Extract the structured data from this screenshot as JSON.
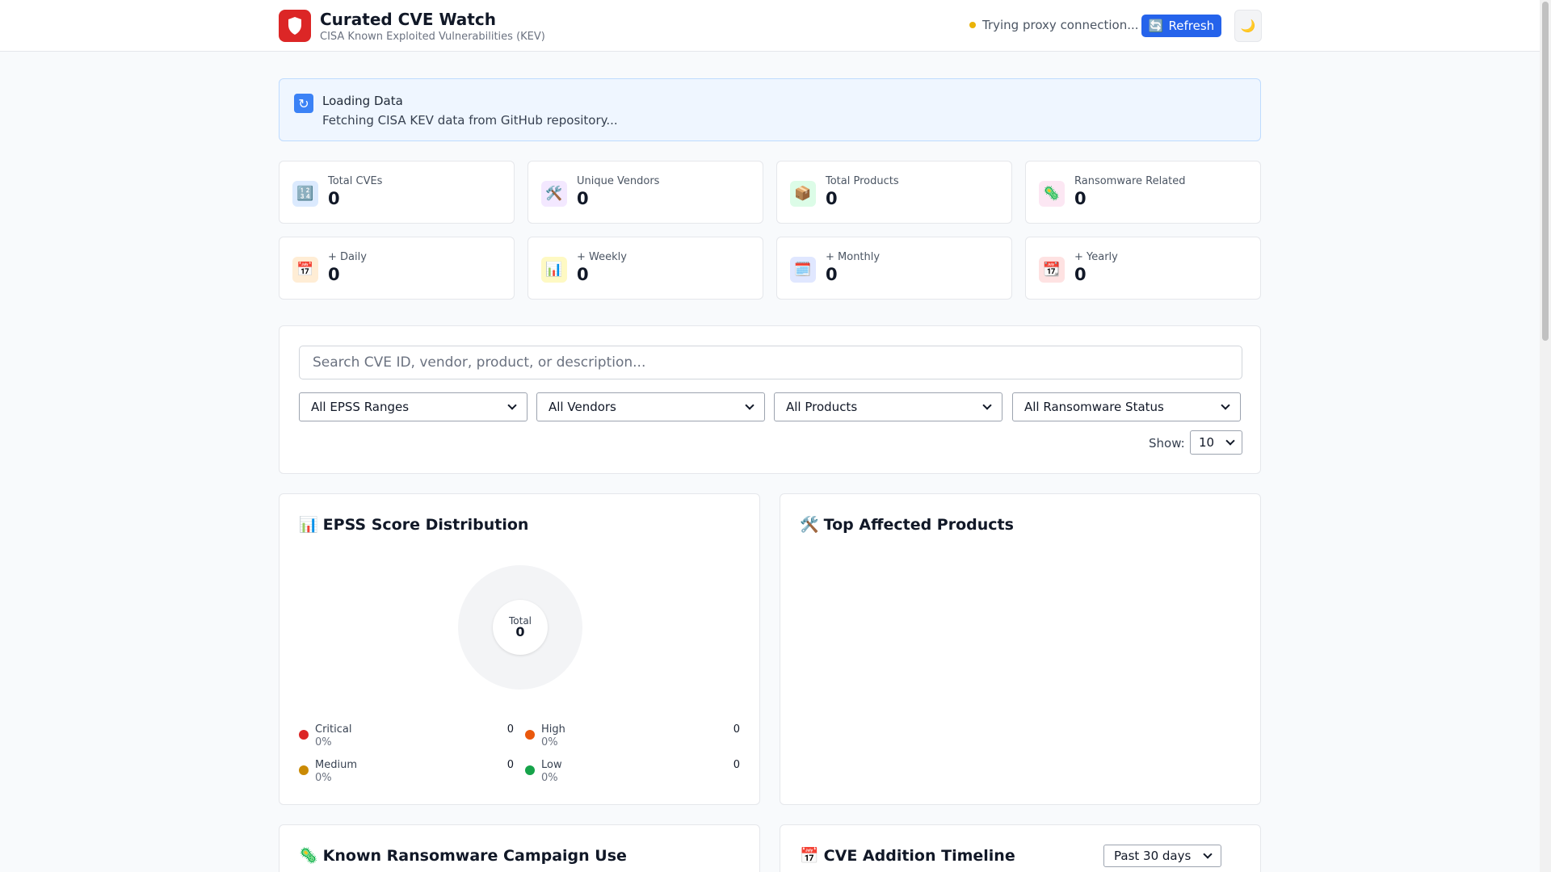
{
  "header": {
    "title": "Curated CVE Watch",
    "subtitle": "CISA Known Exploited Vulnerabilities (KEV)",
    "status": "Trying proxy connection...",
    "refresh_label": "Refresh",
    "refresh_icon": "🔄",
    "theme_icon": "🌙"
  },
  "banner": {
    "title": "Loading Data",
    "text": "Fetching CISA KEV data from GitHub repository..."
  },
  "stats": [
    {
      "label": "Total CVEs",
      "value": "0",
      "icon": "🔢",
      "icon_bg": "#dbeafe"
    },
    {
      "label": "Unique Vendors",
      "value": "0",
      "icon": "🛠️",
      "icon_bg": "#f3e8ff"
    },
    {
      "label": "Total Products",
      "value": "0",
      "icon": "📦",
      "icon_bg": "#dcfce7"
    },
    {
      "label": "Ransomware Related",
      "value": "0",
      "icon": "🦠",
      "icon_bg": "#fce7f3"
    },
    {
      "label": "+ Daily",
      "value": "0",
      "icon": "📅",
      "icon_bg": "#ffedd5"
    },
    {
      "label": "+ Weekly",
      "value": "0",
      "icon": "📊",
      "icon_bg": "#fef9c3"
    },
    {
      "label": "+ Monthly",
      "value": "0",
      "icon": "🗓️",
      "icon_bg": "#e0e7ff"
    },
    {
      "label": "+ Yearly",
      "value": "0",
      "icon": "📆",
      "icon_bg": "#fee2e2"
    }
  ],
  "filters": {
    "search_placeholder": "Search CVE ID, vendor, product, or description...",
    "epss": "All EPSS Ranges",
    "vendors": "All Vendors",
    "products": "All Products",
    "ransomware": "All Ransomware Status",
    "show_label": "Show:",
    "show_value": "10"
  },
  "epss_panel": {
    "title": "EPSS Score Distribution",
    "icon": "📊",
    "total_label": "Total",
    "total_value": "0",
    "legend": [
      {
        "name": "Critical",
        "pct": "0%",
        "count": "0",
        "color": "#dc2626"
      },
      {
        "name": "High",
        "pct": "0%",
        "count": "0",
        "color": "#ea580c"
      },
      {
        "name": "Medium",
        "pct": "0%",
        "count": "0",
        "color": "#ca8a04"
      },
      {
        "name": "Low",
        "pct": "0%",
        "count": "0",
        "color": "#16a34a"
      }
    ]
  },
  "products_panel": {
    "title": "Top Affected Products",
    "icon": "🛠️"
  },
  "ransomware_panel": {
    "title": "Known Ransomware Campaign Use",
    "icon": "🦠"
  },
  "timeline_panel": {
    "title": "CVE Addition Timeline",
    "icon": "📅",
    "range": "Past 30 days"
  }
}
